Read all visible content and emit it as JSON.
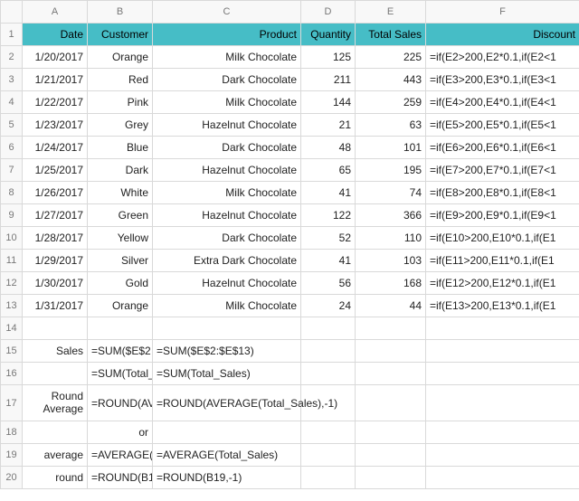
{
  "columns": [
    "A",
    "B",
    "C",
    "D",
    "E",
    "F"
  ],
  "header": {
    "A": "Date",
    "B": "Customer",
    "C": "Product",
    "D": "Quantity",
    "E": "Total Sales",
    "F": "Discount"
  },
  "rows": [
    {
      "n": "2",
      "A": "1/20/2017",
      "B": "Orange",
      "C": "Milk Chocolate",
      "D": "125",
      "E": "225",
      "F": "=if(E2>200,E2*0.1,if(E2<1"
    },
    {
      "n": "3",
      "A": "1/21/2017",
      "B": "Red",
      "C": "Dark Chocolate",
      "D": "211",
      "E": "443",
      "F": "=if(E3>200,E3*0.1,if(E3<1"
    },
    {
      "n": "4",
      "A": "1/22/2017",
      "B": "Pink",
      "C": "Milk Chocolate",
      "D": "144",
      "E": "259",
      "F": "=if(E4>200,E4*0.1,if(E4<1"
    },
    {
      "n": "5",
      "A": "1/23/2017",
      "B": "Grey",
      "C": "Hazelnut Chocolate",
      "D": "21",
      "E": "63",
      "F": "=if(E5>200,E5*0.1,if(E5<1"
    },
    {
      "n": "6",
      "A": "1/24/2017",
      "B": "Blue",
      "C": "Dark Chocolate",
      "D": "48",
      "E": "101",
      "F": "=if(E6>200,E6*0.1,if(E6<1"
    },
    {
      "n": "7",
      "A": "1/25/2017",
      "B": "Dark",
      "C": "Hazelnut Chocolate",
      "D": "65",
      "E": "195",
      "F": "=if(E7>200,E7*0.1,if(E7<1"
    },
    {
      "n": "8",
      "A": "1/26/2017",
      "B": "White",
      "C": "Milk Chocolate",
      "D": "41",
      "E": "74",
      "F": "=if(E8>200,E8*0.1,if(E8<1"
    },
    {
      "n": "9",
      "A": "1/27/2017",
      "B": "Green",
      "C": "Hazelnut Chocolate",
      "D": "122",
      "E": "366",
      "F": "=if(E9>200,E9*0.1,if(E9<1"
    },
    {
      "n": "10",
      "A": "1/28/2017",
      "B": "Yellow",
      "C": "Dark Chocolate",
      "D": "52",
      "E": "110",
      "F": "=if(E10>200,E10*0.1,if(E1"
    },
    {
      "n": "11",
      "A": "1/29/2017",
      "B": "Silver",
      "C": "Extra Dark Chocolate",
      "D": "41",
      "E": "103",
      "F": "=if(E11>200,E11*0.1,if(E1"
    },
    {
      "n": "12",
      "A": "1/30/2017",
      "B": "Gold",
      "C": "Hazelnut Chocolate",
      "D": "56",
      "E": "168",
      "F": "=if(E12>200,E12*0.1,if(E1"
    },
    {
      "n": "13",
      "A": "1/31/2017",
      "B": "Orange",
      "C": "Milk Chocolate",
      "D": "24",
      "E": "44",
      "F": "=if(E13>200,E13*0.1,if(E1"
    }
  ],
  "extra": {
    "r14": {
      "n": "14"
    },
    "r15": {
      "n": "15",
      "A": "Sales",
      "B": "=SUM($E$2",
      "C": "=SUM($E$2:$E$13)"
    },
    "r16": {
      "n": "16",
      "B": "=SUM(Total_",
      "C": "=SUM(Total_Sales)"
    },
    "r17": {
      "n": "17",
      "A": "Round Average",
      "B": "=ROUND(AV",
      "C": "=ROUND(AVERAGE(Total_Sales),-1)"
    },
    "r18": {
      "n": "18",
      "B": "or"
    },
    "r19": {
      "n": "19",
      "A": "average",
      "B": "=AVERAGE(",
      "C": "=AVERAGE(Total_Sales)"
    },
    "r20": {
      "n": "20",
      "A": "round",
      "B": "=ROUND(B1",
      "C": "=ROUND(B19,-1)"
    }
  },
  "chart_data": {
    "type": "table",
    "columns": [
      "Date",
      "Customer",
      "Product",
      "Quantity",
      "Total Sales",
      "Discount"
    ],
    "records": [
      [
        "1/20/2017",
        "Orange",
        "Milk Chocolate",
        125,
        225,
        "=if(E2>200,E2*0.1,if(E2<1"
      ],
      [
        "1/21/2017",
        "Red",
        "Dark Chocolate",
        211,
        443,
        "=if(E3>200,E3*0.1,if(E3<1"
      ],
      [
        "1/22/2017",
        "Pink",
        "Milk Chocolate",
        144,
        259,
        "=if(E4>200,E4*0.1,if(E4<1"
      ],
      [
        "1/23/2017",
        "Grey",
        "Hazelnut Chocolate",
        21,
        63,
        "=if(E5>200,E5*0.1,if(E5<1"
      ],
      [
        "1/24/2017",
        "Blue",
        "Dark Chocolate",
        48,
        101,
        "=if(E6>200,E6*0.1,if(E6<1"
      ],
      [
        "1/25/2017",
        "Dark",
        "Hazelnut Chocolate",
        65,
        195,
        "=if(E7>200,E7*0.1,if(E7<1"
      ],
      [
        "1/26/2017",
        "White",
        "Milk Chocolate",
        41,
        74,
        "=if(E8>200,E8*0.1,if(E8<1"
      ],
      [
        "1/27/2017",
        "Green",
        "Hazelnut Chocolate",
        122,
        366,
        "=if(E9>200,E9*0.1,if(E9<1"
      ],
      [
        "1/28/2017",
        "Yellow",
        "Dark Chocolate",
        52,
        110,
        "=if(E10>200,E10*0.1,if(E1"
      ],
      [
        "1/29/2017",
        "Silver",
        "Extra Dark Chocolate",
        41,
        103,
        "=if(E11>200,E11*0.1,if(E1"
      ],
      [
        "1/30/2017",
        "Gold",
        "Hazelnut Chocolate",
        56,
        168,
        "=if(E12>200,E12*0.1,if(E1"
      ],
      [
        "1/31/2017",
        "Orange",
        "Milk Chocolate",
        24,
        44,
        "=if(E13>200,E13*0.1,if(E1"
      ]
    ]
  }
}
